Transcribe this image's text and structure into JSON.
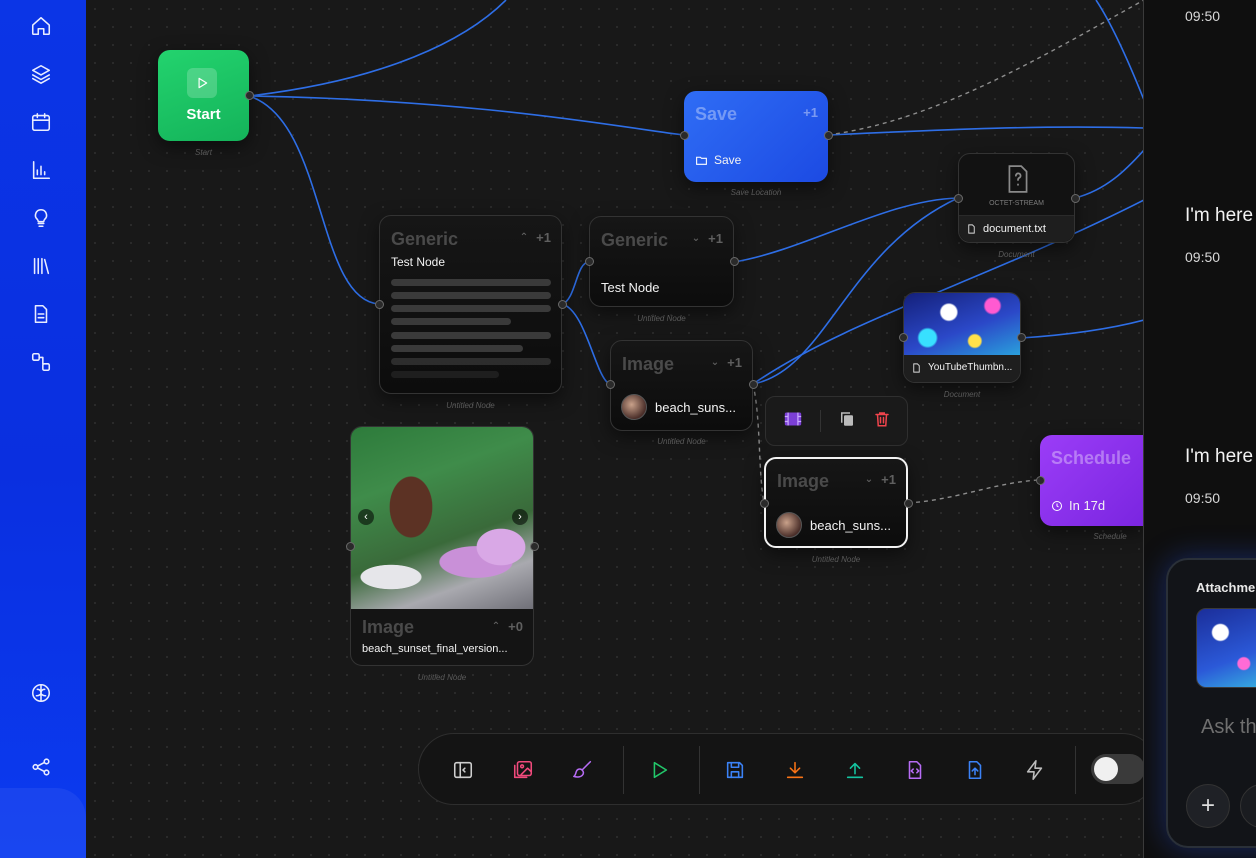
{
  "sidebar": {
    "items": [
      {
        "name": "home-icon"
      },
      {
        "name": "layers-icon"
      },
      {
        "name": "calendar-icon"
      },
      {
        "name": "bar-chart-icon"
      },
      {
        "name": "lightbulb-icon"
      },
      {
        "name": "library-icon"
      },
      {
        "name": "document-icon"
      },
      {
        "name": "workflow-icon"
      }
    ],
    "bottom": [
      {
        "name": "brain-icon"
      },
      {
        "name": "share-icon"
      }
    ]
  },
  "nodes": {
    "start": {
      "title": "Start",
      "caption": "Start"
    },
    "save": {
      "type": "Save",
      "count": "+1",
      "label": "Save",
      "caption": "Save Location"
    },
    "octet": {
      "mime": "OCTET-STREAM",
      "label": "document.txt",
      "caption": "Document"
    },
    "generic1": {
      "type": "Generic",
      "count": "+1",
      "label": "Test Node",
      "caption": "Untitled Node"
    },
    "generic2": {
      "type": "Generic",
      "count": "+1",
      "label": "Test Node",
      "caption": "Untitled Node"
    },
    "youtube": {
      "label": "YouTubeThumbn...",
      "caption": "Document"
    },
    "image1": {
      "type": "Image",
      "count": "+1",
      "label": "beach_suns...",
      "caption": "Untitled Node"
    },
    "image2": {
      "type": "Image",
      "count": "+1",
      "label": "beach_suns...",
      "caption": "Untitled Node"
    },
    "image_card": {
      "type": "Image",
      "count": "+0",
      "label": "beach_sunset_final_version...",
      "caption": "Untitled Node"
    },
    "schedule": {
      "type": "Schedule",
      "label": "In 17d",
      "caption": "Schedule"
    }
  },
  "chat": {
    "times": [
      "09:50",
      "09:50",
      "09:50"
    ],
    "messages": [
      "I'm here",
      "I'm here"
    ],
    "composer": {
      "attachments_label": "Attachme",
      "placeholder": "Ask th",
      "plus": "+"
    }
  },
  "colors": {
    "sidebar": "#0b35e6",
    "start": "#1fc466",
    "save": "#2a5ef0",
    "schedule": "#8b30ef",
    "edge": "#2e6ee6"
  }
}
